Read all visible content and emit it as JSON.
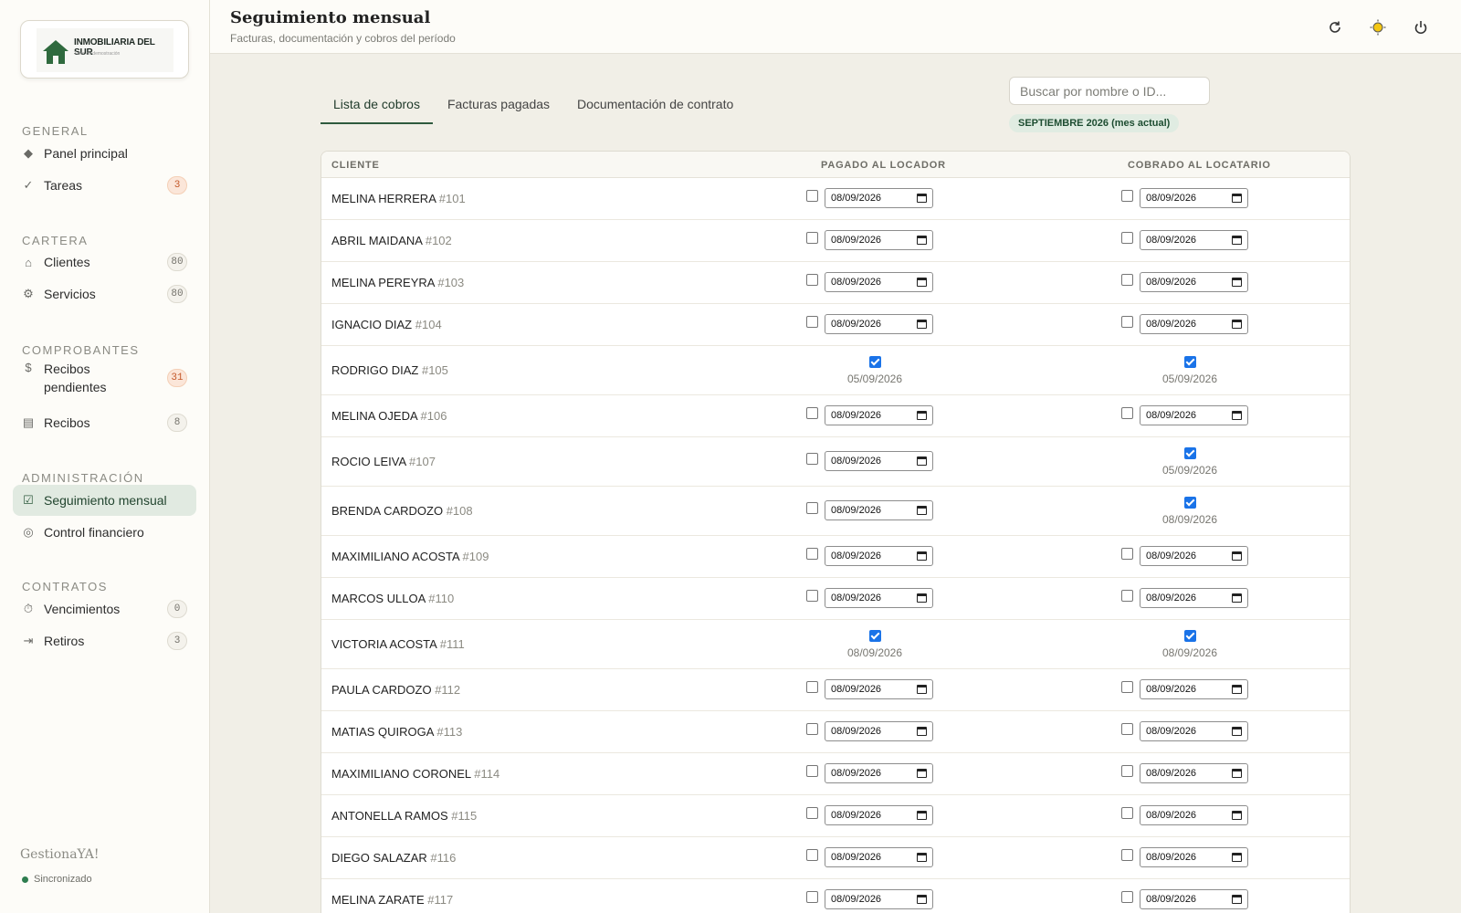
{
  "logo": {
    "name": "INMOBILIARIA DEL SUR",
    "tagline": "Taller de demostración"
  },
  "sidebar": {
    "sections": [
      {
        "title": "GENERAL",
        "items": [
          {
            "icon": "diamond-icon",
            "glyph": "◆",
            "label": "Panel principal",
            "badge": null
          },
          {
            "icon": "check-icon",
            "glyph": "✓",
            "label": "Tareas",
            "badge": "3",
            "badge_style": "orange"
          }
        ]
      },
      {
        "title": "CARTERA",
        "items": [
          {
            "icon": "home-icon",
            "glyph": "⌂",
            "label": "Clientes",
            "badge": "80",
            "badge_style": "gray"
          },
          {
            "icon": "gear-icon",
            "glyph": "⚙",
            "label": "Servicios",
            "badge": "80",
            "badge_style": "gray"
          }
        ]
      },
      {
        "title": "COMPROBANTES",
        "items": [
          {
            "icon": "dollar-icon",
            "glyph": "$",
            "label": "Recibos pendientes",
            "badge": "31",
            "badge_style": "orange"
          },
          {
            "icon": "receipt-icon",
            "glyph": "▤",
            "label": "Recibos",
            "badge": "8",
            "badge_style": "gray"
          }
        ]
      },
      {
        "title": "ADMINISTRACIÓN",
        "items": [
          {
            "icon": "checkbox-icon",
            "glyph": "☑",
            "label": "Seguimiento mensual",
            "badge": null,
            "active": true
          },
          {
            "icon": "coin-icon",
            "glyph": "◎",
            "label": "Control financiero",
            "badge": null
          }
        ]
      },
      {
        "title": "CONTRATOS",
        "items": [
          {
            "icon": "timer-icon",
            "glyph": "⏱",
            "label": "Vencimientos",
            "badge": "0",
            "badge_style": "gray"
          },
          {
            "icon": "exit-icon",
            "glyph": "⇥",
            "label": "Retiros",
            "badge": "3",
            "badge_style": "gray"
          }
        ]
      }
    ],
    "brand": "GestionaYA!",
    "sync_status": "Sincronizado"
  },
  "header": {
    "title": "Seguimiento mensual",
    "subtitle": "Facturas, documentación y cobros del período",
    "actions": [
      {
        "name": "refresh-icon",
        "glyph": "↻"
      },
      {
        "name": "sun-icon",
        "glyph": "☀"
      },
      {
        "name": "power-icon",
        "glyph": "⏻"
      }
    ]
  },
  "tabs": [
    {
      "label": "Lista de cobros",
      "active": true
    },
    {
      "label": "Facturas pagadas",
      "active": false
    },
    {
      "label": "Documentación de contrato",
      "active": false
    }
  ],
  "search": {
    "placeholder": "Buscar por nombre o ID..."
  },
  "period_badge": "SEPTIEMBRE 2026 (mes actual)",
  "table": {
    "columns": [
      "CLIENTE",
      "PAGADO AL LOCADOR",
      "COBRADO AL LOCATARIO"
    ],
    "rows": [
      {
        "name": "MELINA HERRERA",
        "id": "#101",
        "locador": {
          "paid": false,
          "date": "08/09/2026"
        },
        "locatario": {
          "paid": false,
          "date": "08/09/2026"
        }
      },
      {
        "name": "ABRIL MAIDANA",
        "id": "#102",
        "locador": {
          "paid": false,
          "date": "08/09/2026"
        },
        "locatario": {
          "paid": false,
          "date": "08/09/2026"
        }
      },
      {
        "name": "MELINA PEREYRA",
        "id": "#103",
        "locador": {
          "paid": false,
          "date": "08/09/2026"
        },
        "locatario": {
          "paid": false,
          "date": "08/09/2026"
        }
      },
      {
        "name": "IGNACIO DIAZ",
        "id": "#104",
        "locador": {
          "paid": false,
          "date": "08/09/2026"
        },
        "locatario": {
          "paid": false,
          "date": "08/09/2026"
        }
      },
      {
        "name": "RODRIGO DIAZ",
        "id": "#105",
        "locador": {
          "paid": true,
          "date": "05/09/2026"
        },
        "locatario": {
          "paid": true,
          "date": "05/09/2026"
        }
      },
      {
        "name": "MELINA OJEDA",
        "id": "#106",
        "locador": {
          "paid": false,
          "date": "08/09/2026"
        },
        "locatario": {
          "paid": false,
          "date": "08/09/2026"
        }
      },
      {
        "name": "ROCIO LEIVA",
        "id": "#107",
        "locador": {
          "paid": false,
          "date": "08/09/2026"
        },
        "locatario": {
          "paid": true,
          "date": "05/09/2026"
        }
      },
      {
        "name": "BRENDA CARDOZO",
        "id": "#108",
        "locador": {
          "paid": false,
          "date": "08/09/2026"
        },
        "locatario": {
          "paid": true,
          "date": "08/09/2026"
        }
      },
      {
        "name": "MAXIMILIANO ACOSTA",
        "id": "#109",
        "locador": {
          "paid": false,
          "date": "08/09/2026"
        },
        "locatario": {
          "paid": false,
          "date": "08/09/2026"
        }
      },
      {
        "name": "MARCOS ULLOA",
        "id": "#110",
        "locador": {
          "paid": false,
          "date": "08/09/2026"
        },
        "locatario": {
          "paid": false,
          "date": "08/09/2026"
        }
      },
      {
        "name": "VICTORIA ACOSTA",
        "id": "#111",
        "locador": {
          "paid": true,
          "date": "08/09/2026"
        },
        "locatario": {
          "paid": true,
          "date": "08/09/2026"
        }
      },
      {
        "name": "PAULA CARDOZO",
        "id": "#112",
        "locador": {
          "paid": false,
          "date": "08/09/2026"
        },
        "locatario": {
          "paid": false,
          "date": "08/09/2026"
        }
      },
      {
        "name": "MATIAS QUIROGA",
        "id": "#113",
        "locador": {
          "paid": false,
          "date": "08/09/2026"
        },
        "locatario": {
          "paid": false,
          "date": "08/09/2026"
        }
      },
      {
        "name": "MAXIMILIANO CORONEL",
        "id": "#114",
        "locador": {
          "paid": false,
          "date": "08/09/2026"
        },
        "locatario": {
          "paid": false,
          "date": "08/09/2026"
        }
      },
      {
        "name": "ANTONELLA RAMOS",
        "id": "#115",
        "locador": {
          "paid": false,
          "date": "08/09/2026"
        },
        "locatario": {
          "paid": false,
          "date": "08/09/2026"
        }
      },
      {
        "name": "DIEGO SALAZAR",
        "id": "#116",
        "locador": {
          "paid": false,
          "date": "08/09/2026"
        },
        "locatario": {
          "paid": false,
          "date": "08/09/2026"
        }
      },
      {
        "name": "MELINA ZARATE",
        "id": "#117",
        "locador": {
          "paid": false,
          "date": "08/09/2026"
        },
        "locatario": {
          "paid": false,
          "date": "08/09/2026"
        }
      }
    ]
  },
  "colors": {
    "accent": "#2f5a3e",
    "checkbox": "#1a73e8",
    "badge_orange": "#c4582a"
  }
}
